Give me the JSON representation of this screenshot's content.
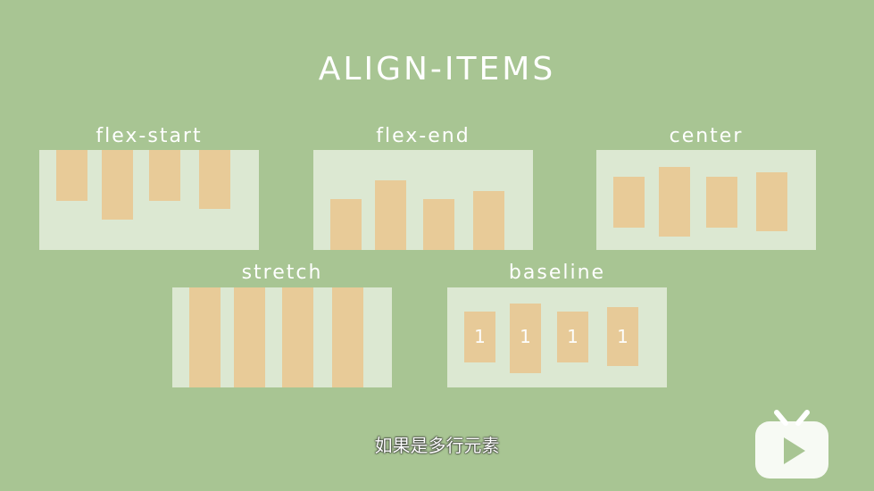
{
  "title": "ALIGN-ITEMS",
  "panels": {
    "flex_start": {
      "label": "flex-start"
    },
    "flex_end": {
      "label": "flex-end"
    },
    "center": {
      "label": "center"
    },
    "stretch": {
      "label": "stretch"
    },
    "baseline": {
      "label": "baseline",
      "item_text": [
        "1",
        "1",
        "1",
        "1"
      ]
    }
  },
  "subtitle": "如果是多行元素",
  "colors": {
    "background": "#a8c593",
    "panel": "#dce8d2",
    "item": "#e8c995",
    "text": "#ffffff"
  },
  "logo": {
    "icon": "tv-play-icon"
  }
}
